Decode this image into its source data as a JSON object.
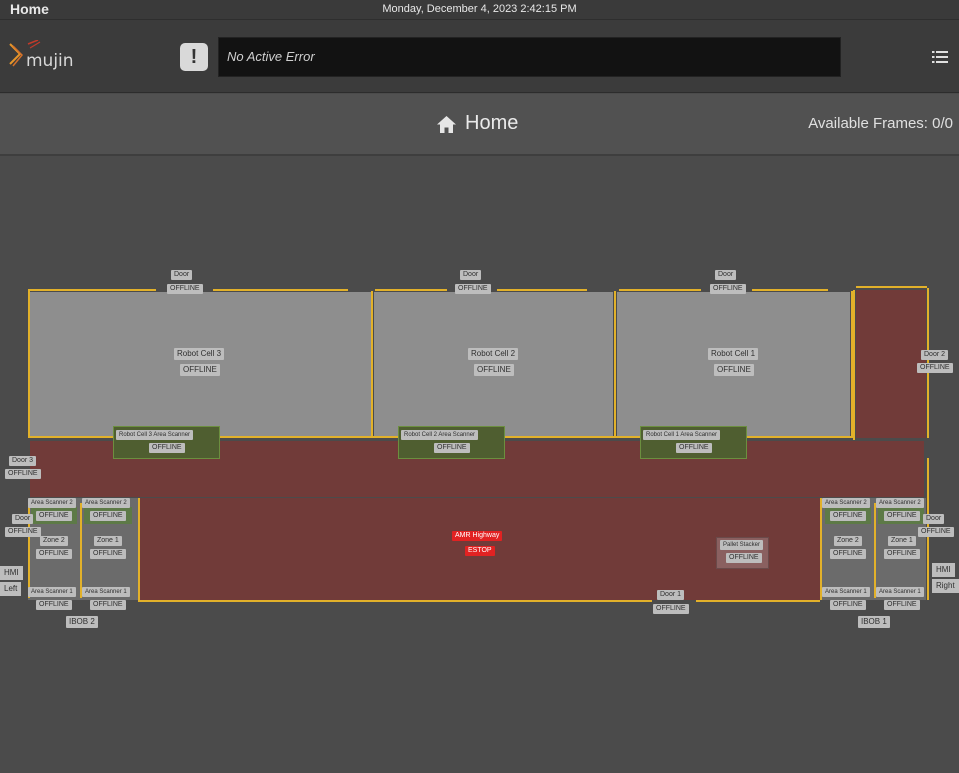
{
  "system_bar": {
    "page": "Home",
    "datetime": "Monday, December 4, 2023 2:42:15 PM"
  },
  "header": {
    "logo_text": "mujin",
    "error_text": "No Active Error",
    "error_icon": "exclamation-icon",
    "menu_icon": "list-icon"
  },
  "title": {
    "icon": "home-icon",
    "text": "Home",
    "frames": "Available Frames: 0/0"
  },
  "map": {
    "offline": "OFFLINE",
    "doors_top": [
      "Door",
      "Door",
      "Door"
    ],
    "cells": [
      "Robot Cell 3",
      "Robot Cell 2",
      "Robot Cell 1"
    ],
    "cell_scanners": [
      "Robot Cell 3 Area Scanner",
      "Robot Cell 2 Area Scanner",
      "Robot Cell 1 Area Scanner"
    ],
    "door2": "Door 2",
    "door3": "Door 3",
    "door1": "Door 1",
    "door_left": "Door",
    "door_right": "Door",
    "amr": {
      "name": "AMR Highway",
      "status": "ESTOP",
      "status_color": "#e22222"
    },
    "pallet_stacker": "Pallet Stacker",
    "ibob2": {
      "name": "IBOB 2",
      "scanner_top_a": "Area Scanner 2",
      "scanner_top_b": "Area Scanner 2",
      "zone_a": "Zone 2",
      "zone_b": "Zone 1",
      "scanner_bottom_a": "Area Scanner 1",
      "scanner_bottom_b": "Area Scanner 1"
    },
    "ibob1": {
      "name": "IBOB 1",
      "scanner_top_a": "Area Scanner 2",
      "scanner_top_b": "Area Scanner 2",
      "zone_a": "Zone 2",
      "zone_b": "Zone 1",
      "scanner_bottom_a": "Area Scanner 1",
      "scanner_bottom_b": "Area Scanner 1"
    },
    "hmi_left": {
      "line1": "HMI",
      "line2": "Left"
    },
    "hmi_right": {
      "line1": "HMI",
      "line2": "Right"
    }
  }
}
